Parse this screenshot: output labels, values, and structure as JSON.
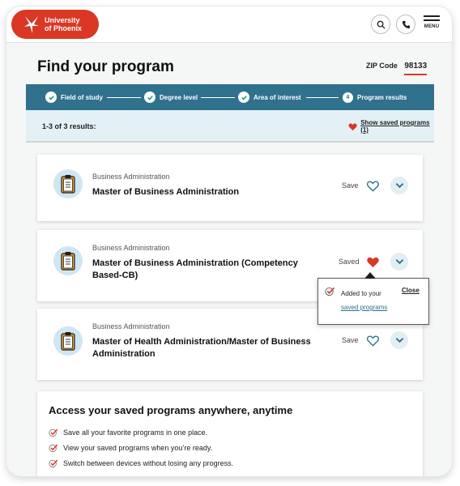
{
  "header": {
    "logo_line1": "University",
    "logo_line2": "of Phoenix",
    "menu_label": "MENU"
  },
  "page_title": "Find your program",
  "zip": {
    "label": "ZIP Code",
    "value": "98133"
  },
  "steps": [
    {
      "label": "Field of study",
      "state": "complete"
    },
    {
      "label": "Degree level",
      "state": "complete"
    },
    {
      "label": "Area of interest",
      "state": "complete"
    },
    {
      "label": "Program results",
      "state": "current",
      "number": "4"
    }
  ],
  "results": {
    "count": "1-3 of 3 results:",
    "saved_link": "Show saved programs (1)"
  },
  "programs": [
    {
      "category": "Business Administration",
      "name": "Master of Business Administration",
      "save_label": "Save",
      "saved": false
    },
    {
      "category": "Business Administration",
      "name": "Master of Business Administration (Competency Based-CB)",
      "save_label": "Saved",
      "saved": true
    },
    {
      "category": "Business Administration",
      "name": "Master of Health Administration/Master of Business Administration",
      "save_label": "Save",
      "saved": false
    }
  ],
  "popup": {
    "line1": "Added to your",
    "link": "saved programs",
    "close": "Close"
  },
  "promo": {
    "title": "Access your saved programs anywhere, anytime",
    "bullets": [
      "Save all your favorite programs in one place.",
      "View your saved programs when you’re ready.",
      "Switch between devices without losing any progress."
    ]
  },
  "colors": {
    "brand_red": "#db3725",
    "stepper_teal": "#30718d",
    "results_bg": "#e3f1f6"
  }
}
